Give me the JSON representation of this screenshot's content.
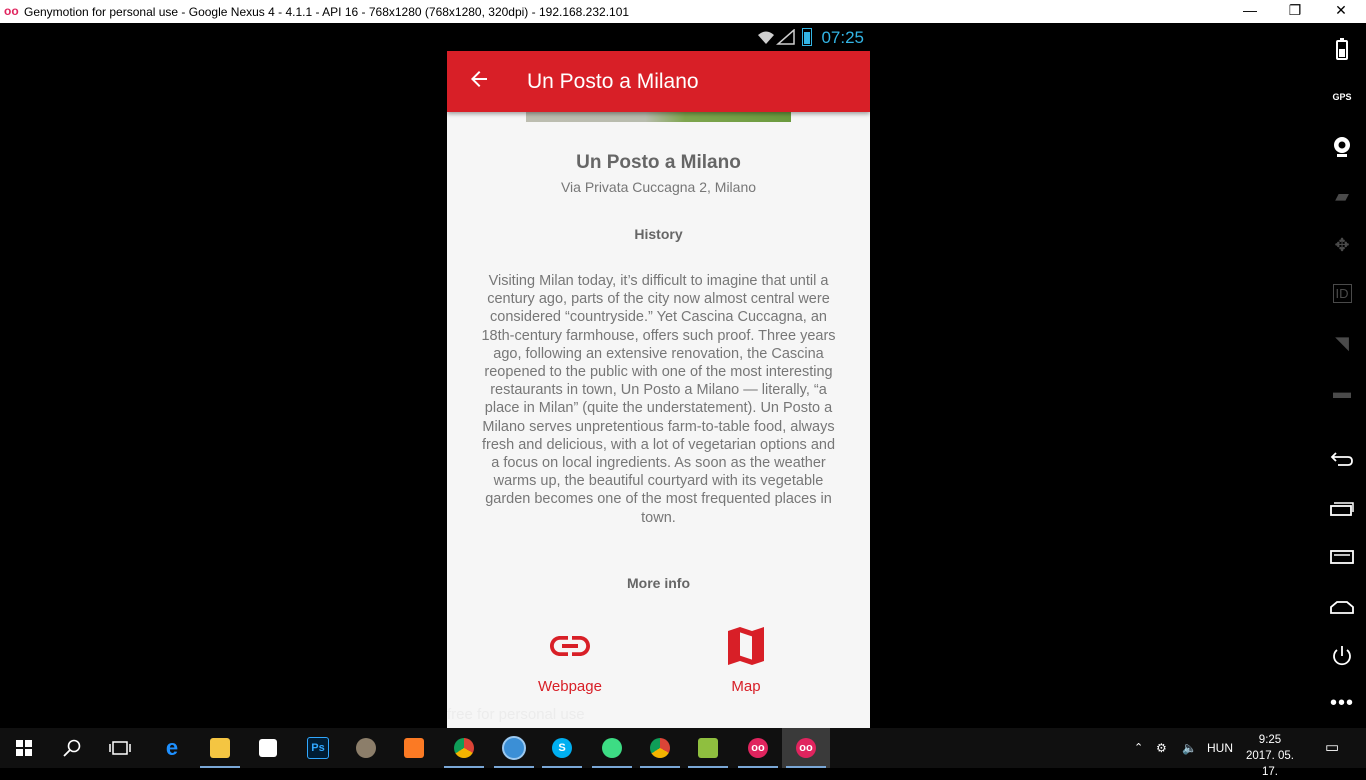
{
  "window": {
    "title": "Genymotion for personal use - Google Nexus 4 - 4.1.1 - API 16 - 768x1280 (768x1280, 320dpi) - 192.168.232.101",
    "app_icon": "oo",
    "minimize": "—",
    "restore": "❐",
    "close": "✕"
  },
  "statusbar": {
    "time": "07:25"
  },
  "appbar": {
    "title": "Un Posto a Milano"
  },
  "place": {
    "name": "Un Posto a Milano",
    "address": "Via Privata Cuccagna 2, Milano"
  },
  "history": {
    "heading": "History",
    "text": "Visiting Milan today, it’s difficult to imagine that until a century ago, parts of the city now almost central were considered “countryside.” Yet Cascina Cuccagna, an 18th-century farmhouse, offers such proof. Three years ago, following an extensive renovation, the Cascina reopened to the public with one of the most interesting restaurants in town, Un Posto a Milano — literally, “a place in Milan” (quite the understatement). Un Posto a Milano serves unpretentious farm-to-table food, always fresh and delicious, with a lot of vegetarian options and a focus on local ingredients. As soon as the weather warms up, the beautiful courtyard with its vegetable garden becomes one of the most frequented places in town."
  },
  "more_info": {
    "heading": "More info",
    "webpage_label": "Webpage",
    "map_label": "Map"
  },
  "watermark": "free for personal use",
  "colors": {
    "accent": "#d81f27",
    "status_blue": "#33b5e5"
  },
  "genymotion_toolbar": [
    "battery-icon",
    "gps-icon",
    "webcam-icon",
    "capture-icon",
    "dpad-icon",
    "id-icon",
    "network-icon",
    "sms-icon",
    "back-icon",
    "recent-apps-icon",
    "menu-icon",
    "home-icon",
    "power-icon",
    "more-icon"
  ],
  "gps_label": "GPS",
  "id_label": "ID",
  "taskbar": {
    "language": "HUN",
    "time": "9:25",
    "date": "2017. 05. 17.",
    "apps": [
      "start-icon",
      "search-icon",
      "task-view-icon",
      "edge-icon",
      "file-explorer-icon",
      "store-icon",
      "photoshop-icon",
      "gimp-icon",
      "xampp-icon",
      "chrome-icon",
      "app-icon",
      "skype-icon",
      "android-studio-icon",
      "chrome-icon",
      "notepad-icon",
      "genymotion-icon",
      "genymotion-player-icon"
    ],
    "ps_label": "Ps"
  }
}
